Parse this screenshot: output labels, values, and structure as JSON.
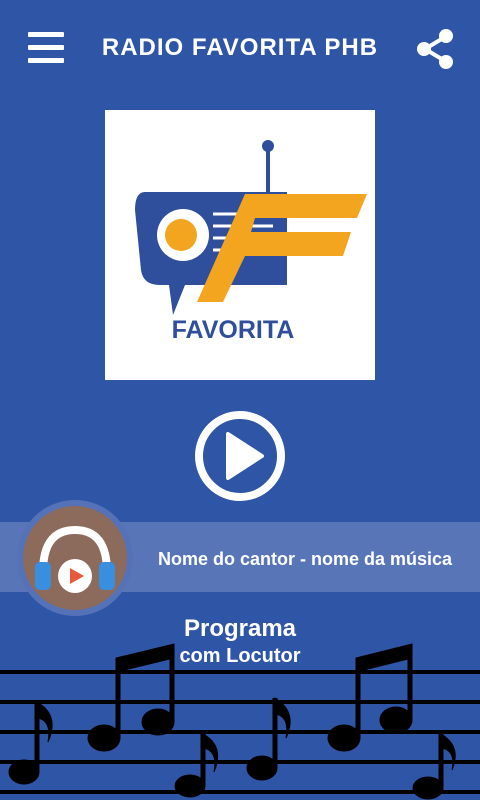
{
  "header": {
    "title": "RADIO FAVORITA PHB",
    "menu_icon": "hamburger-menu-icon",
    "share_icon": "share-icon"
  },
  "logo": {
    "text": "FAVORITA",
    "colors": {
      "blue": "#2f4f9c",
      "orange": "#f3a51f"
    }
  },
  "player": {
    "play_icon": "play-icon"
  },
  "now_playing": {
    "track": "Nome do cantor - nome da música",
    "art_icon": "headphones-icon"
  },
  "program": {
    "title": "Programa",
    "host": "com Locutor"
  },
  "theme": {
    "background": "#2f55a6",
    "band": "#8ca0cd",
    "art_circle": "#8c6a5c"
  }
}
